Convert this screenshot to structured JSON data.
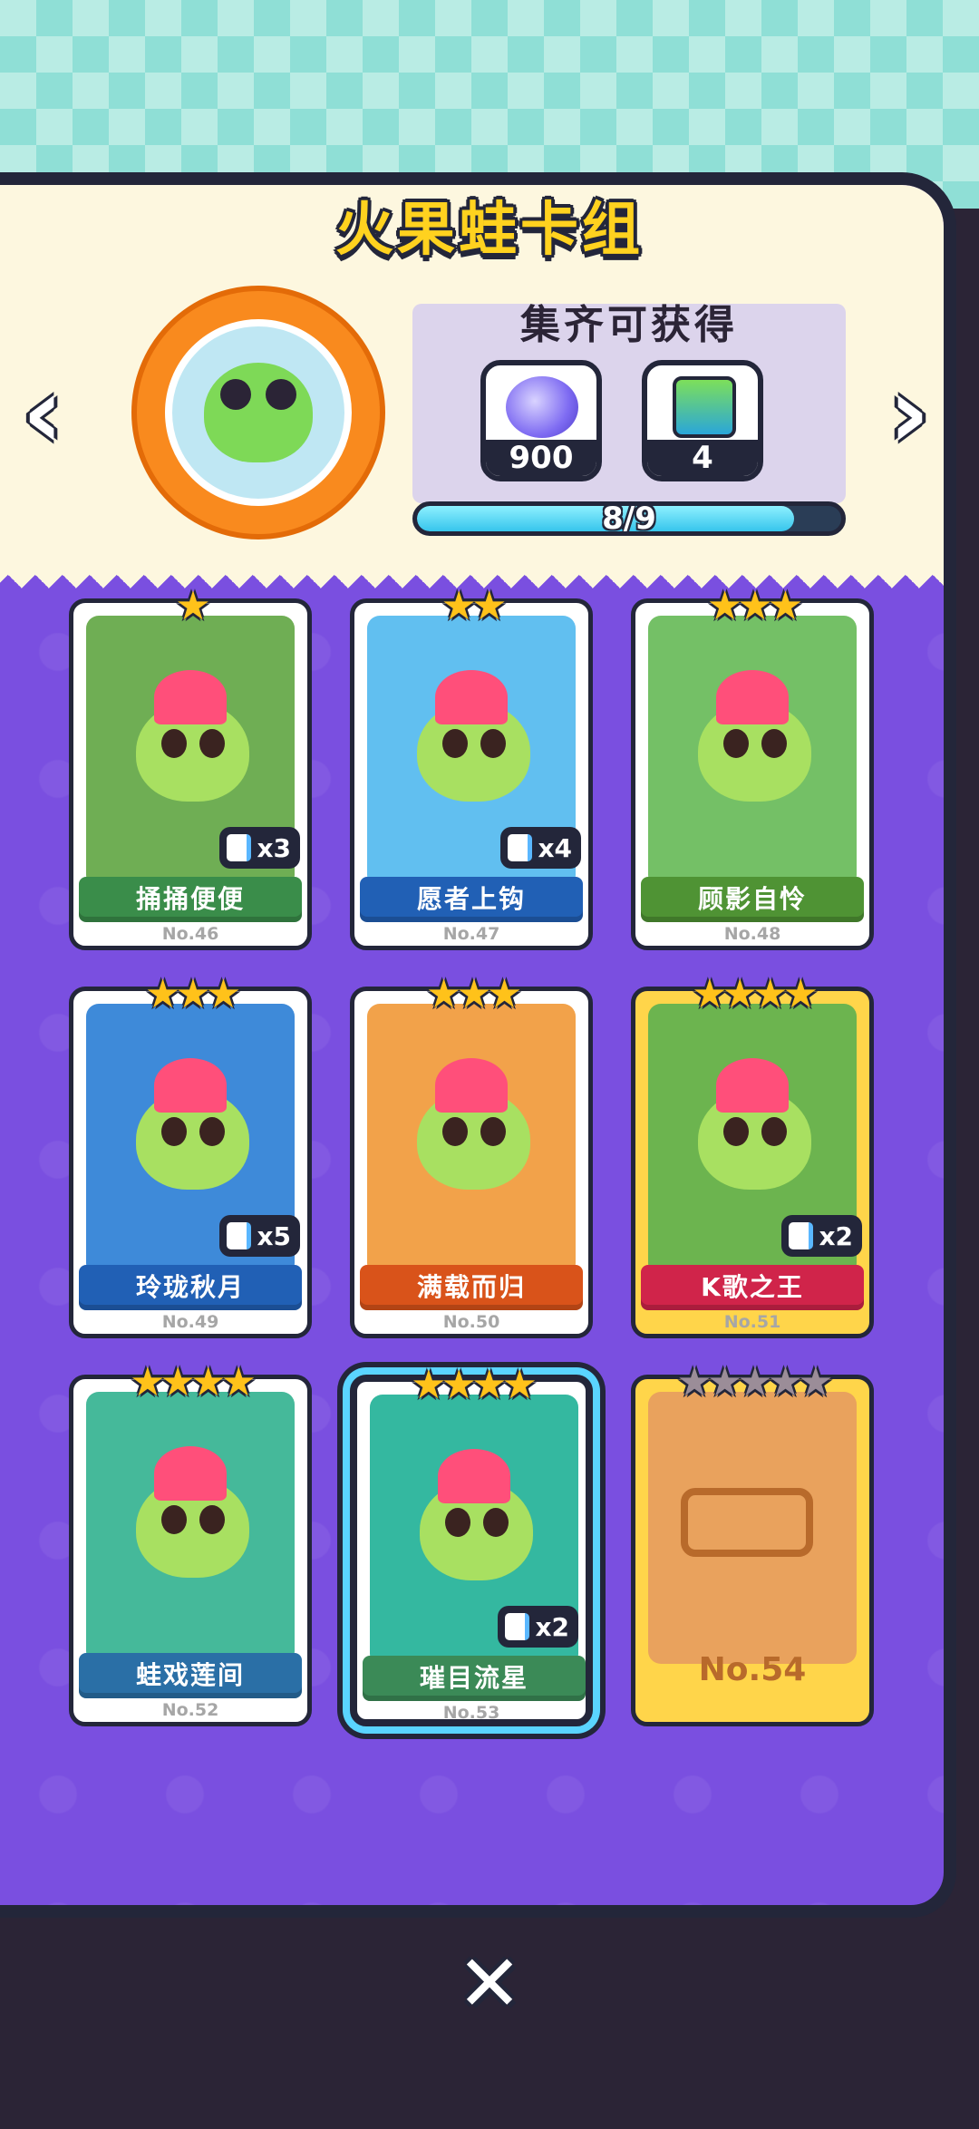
{
  "title": "火果蛙卡组",
  "nav": {
    "prev_icon": "‹",
    "next_icon": "›"
  },
  "reward": {
    "title": "集齐可获得",
    "items": [
      {
        "icon": "purple-orb-icon",
        "count": "900"
      },
      {
        "icon": "card-pack-icon",
        "count": "4"
      }
    ],
    "progress": {
      "text": "8/9",
      "fraction": 0.889
    }
  },
  "cards": [
    {
      "name": "捅捅便便",
      "no": "No.46",
      "stars": "★",
      "dup": "x3",
      "ribbon_color": "#3a8d4a",
      "art_color": "#6fae54"
    },
    {
      "name": "愿者上钩",
      "no": "No.47",
      "stars": "★★",
      "dup": "x4",
      "ribbon_color": "#2160b5",
      "art_color": "#61bff0"
    },
    {
      "name": "顾影自怜",
      "no": "No.48",
      "stars": "★★★",
      "dup": "",
      "ribbon_color": "#4f9334",
      "art_color": "#74c066"
    },
    {
      "name": "玲珑秋月",
      "no": "No.49",
      "stars": "★★★",
      "dup": "x5",
      "ribbon_color": "#2160b5",
      "art_color": "#3e8ad9"
    },
    {
      "name": "满载而归",
      "no": "No.50",
      "stars": "★★★",
      "dup": "",
      "ribbon_color": "#d9531a",
      "art_color": "#f2a24a"
    },
    {
      "name": "K歌之王",
      "no": "No.51",
      "stars": "★★★★",
      "dup": "x2",
      "ribbon_color": "#d0244a",
      "art_color": "#6cb44f"
    },
    {
      "name": "蛙戏莲间",
      "no": "No.52",
      "stars": "★★★★",
      "dup": "",
      "ribbon_color": "#2a6fa6",
      "art_color": "#45b99a"
    },
    {
      "name": "璀目流星",
      "no": "No.53",
      "stars": "★★★★",
      "dup": "x2",
      "ribbon_color": "#3b8a57",
      "art_color": "#34b8a0"
    },
    {
      "name": "",
      "no": "No.54",
      "stars": "★★★★★",
      "dup": "",
      "ribbon_color": "",
      "art_color": "#e9a25d"
    }
  ],
  "close_icon": "✕"
}
